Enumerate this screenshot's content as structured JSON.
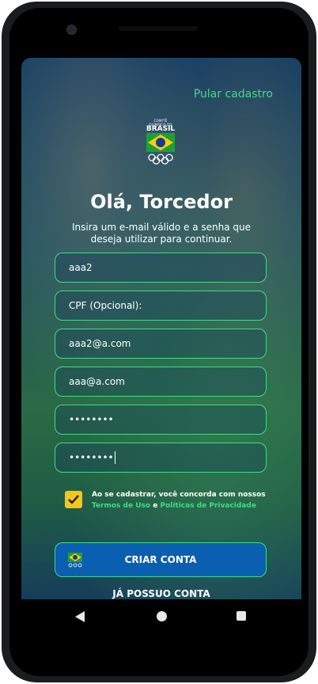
{
  "app": {
    "skip_label": "Pular cadastro",
    "logo_top": "COMITÊ OLÍMPICO DO",
    "logo_brand": "BRASIL",
    "title": "Olá, Torcedor",
    "subtitle": "Insira um e-mail válido e a senha que deseja utilizar para continuar."
  },
  "form": {
    "name_value": "aaa2",
    "cpf_placeholder": "CPF (Opcional):",
    "email_value": "aaa2@a.com",
    "email_confirm_value": "aaa@a.com",
    "password_value": "••••••••",
    "password_confirm_value": "••••••••"
  },
  "terms": {
    "text": "Ao se cadastrar, você concorda com nossos",
    "terms_link": "Termos de Uso",
    "connector": "e",
    "privacy_link": "Políticas de Privacidade",
    "checked": true
  },
  "actions": {
    "create_label": "CRIAR CONTA",
    "login_label": "JÁ POSSUO CONTA"
  },
  "colors": {
    "accent": "#3ddc84",
    "button": "#0a5fb0",
    "checkbox": "#f5c518"
  },
  "icons": {
    "back": "back-triangle-icon",
    "home": "home-circle-icon",
    "recent": "recent-square-icon"
  }
}
